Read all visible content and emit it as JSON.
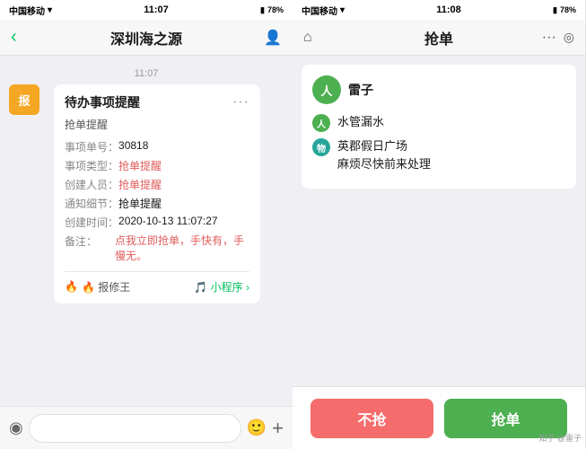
{
  "phone_left": {
    "status": {
      "carrier": "中国移动",
      "wifi": "WiFi",
      "time": "11:07",
      "battery_icon": "🔋",
      "battery": "78%"
    },
    "nav": {
      "title": "深圳海之源",
      "back_label": "‹",
      "profile_label": "👤"
    },
    "timestamp": "11:07",
    "card": {
      "title": "待办事项提醒",
      "subtitle": "抢单提醒",
      "rows": [
        {
          "label": "事项单号：",
          "value": "30818",
          "color": "normal"
        },
        {
          "label": "事项类型：",
          "value": "抢单提醒",
          "color": "red"
        },
        {
          "label": "创建人员：",
          "value": "抢单提醒",
          "color": "red"
        },
        {
          "label": "通知细节：",
          "value": "抢单提醒",
          "color": "normal"
        },
        {
          "label": "创建时间：",
          "value": "2020-10-13 11:07:27",
          "color": "normal"
        },
        {
          "label": "备注：",
          "value": "点我立即抢单，手快有，手慢无。",
          "color": "red"
        }
      ],
      "footer_left": "🔥 报修王",
      "footer_right": "🎵 小程序 ›"
    },
    "bottom": {
      "voice_btn": "◉",
      "emoji_btn": "🙂",
      "plus_btn": "+"
    }
  },
  "phone_right": {
    "status": {
      "carrier": "中国移动",
      "wifi": "WiFi",
      "time": "11:08",
      "battery_icon": "🔋",
      "battery": "78%"
    },
    "nav": {
      "home_label": "⌂",
      "title": "抢单",
      "dots_label": "···",
      "circle_label": "◎"
    },
    "card": {
      "user_avatar": "人",
      "username": "雷子",
      "info_rows": [
        {
          "badge_type": "green",
          "badge_label": "人",
          "text": "水管漏水"
        },
        {
          "badge_type": "teal",
          "badge_label": "物",
          "text": "英郡假日广场\n麻烦尽快前来处理"
        }
      ]
    },
    "buttons": {
      "no_label": "不抢",
      "yes_label": "抢单"
    }
  },
  "watermark": "知乎 @雷子"
}
